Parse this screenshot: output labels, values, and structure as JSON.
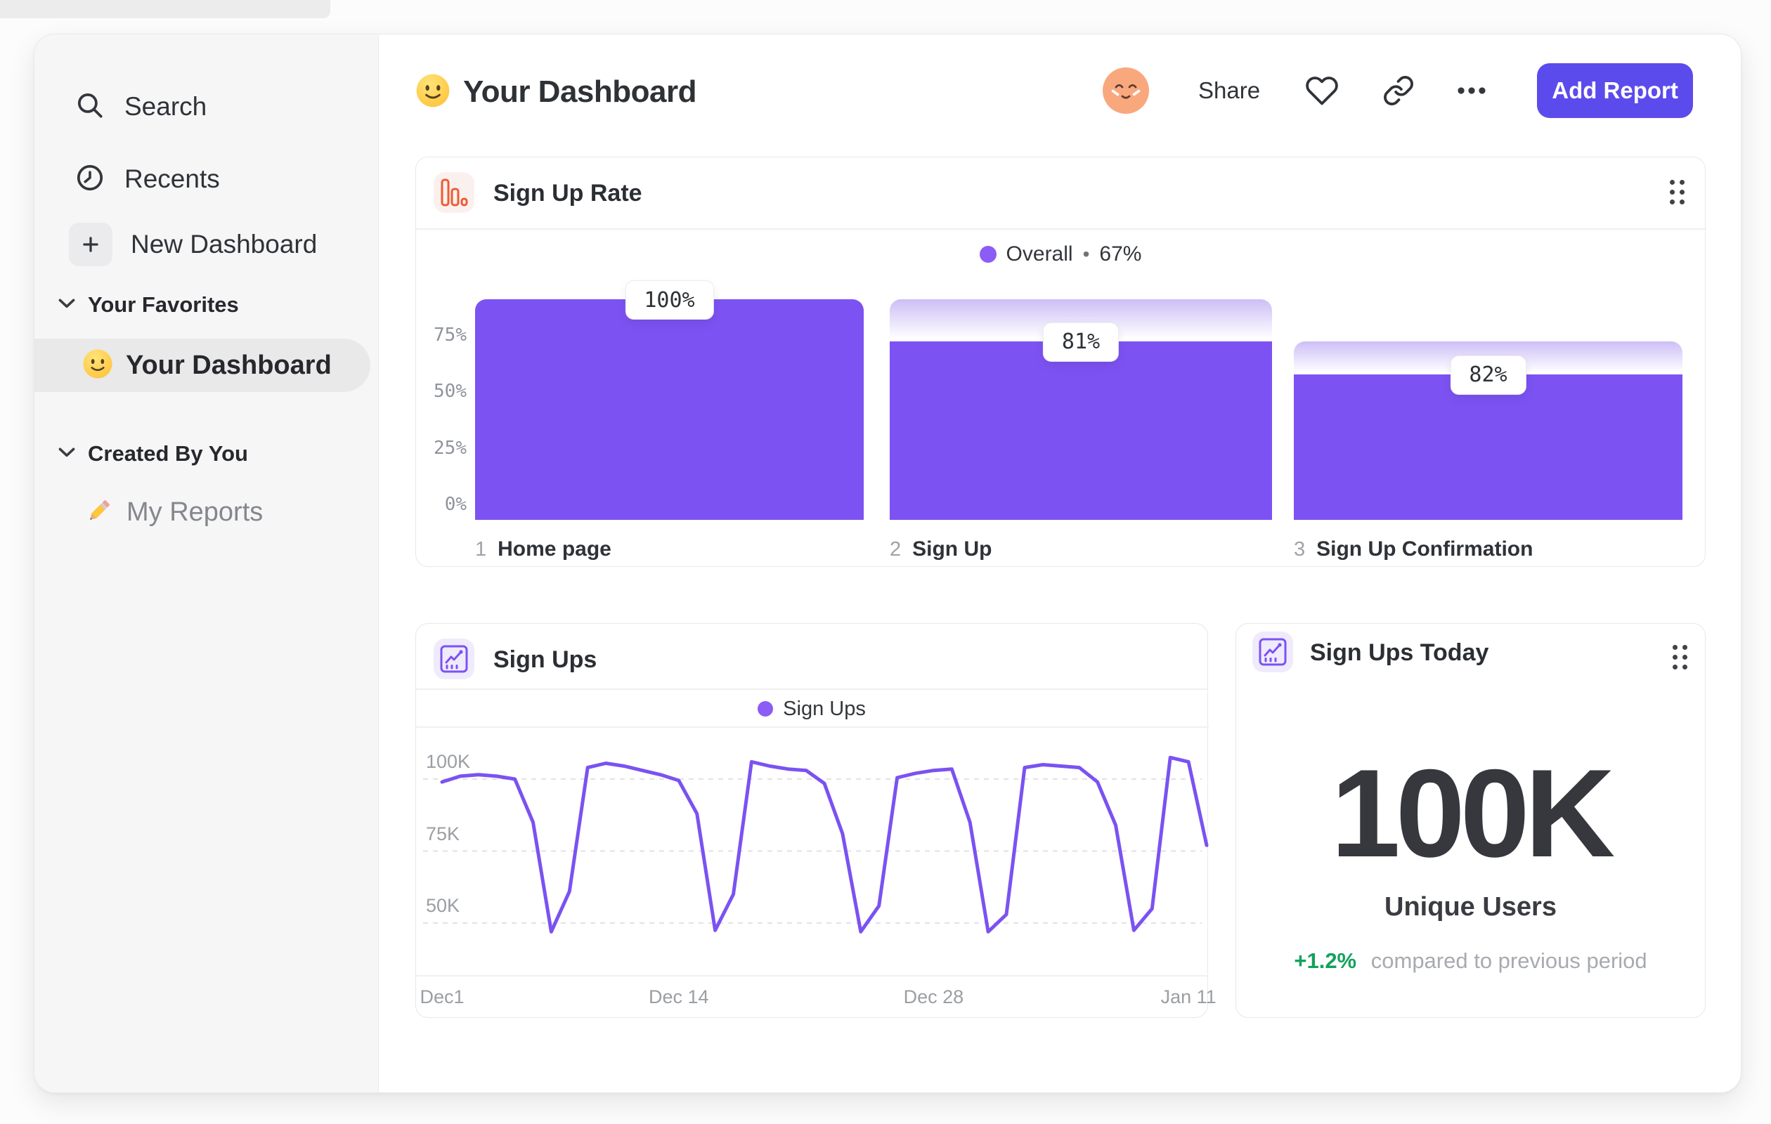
{
  "legend_bullet": "•",
  "sidebar": {
    "items": [
      {
        "label": "Search",
        "icon": "search"
      },
      {
        "label": "Recents",
        "icon": "clock-history"
      },
      {
        "label": "New Dashboard",
        "icon": "plus"
      }
    ],
    "sections": [
      {
        "title": "Your Favorites",
        "items": [
          {
            "label": "Your Dashboard",
            "emoji": "slightly-smiling-face",
            "selected": true
          }
        ]
      },
      {
        "title": "Created By You",
        "items": [
          {
            "label": "My Reports",
            "emoji": "pencil",
            "selected": false
          }
        ]
      }
    ]
  },
  "header": {
    "title": "Your Dashboard",
    "title_emoji": "slightly-smiling-face",
    "avatar": "relieved-face-on-peach-circle",
    "share_label": "Share",
    "icons": [
      "heart",
      "link",
      "ellipsis"
    ],
    "add_report_label": "Add Report",
    "accent_color": "#5C4BEC"
  },
  "colors": {
    "bar_purple": "#7C52F2",
    "line_purple": "#7B52F1",
    "legend_dot": "#8B5CF6",
    "delta_green": "#11A25C",
    "funnel_icon_orange": "#EE5B33"
  },
  "chart_data": [
    {
      "type": "bar",
      "subtype": "funnel",
      "title": "Sign Up Rate",
      "legend": {
        "label": "Overall",
        "value": "67%",
        "color": "#8B5CF6"
      },
      "ylim": [
        0,
        100
      ],
      "y_ticks": [
        "75%",
        "50%",
        "25%",
        "0%"
      ],
      "bar_color": "#7C52F2",
      "steps": [
        {
          "step": "1",
          "name": "Home page",
          "label": "100%",
          "conversion_from_prev_pct": 100,
          "solid_pct": 100,
          "ghost_top_pct": 100
        },
        {
          "step": "2",
          "name": "Sign Up",
          "label": "81%",
          "conversion_from_prev_pct": 81,
          "solid_pct": 81,
          "ghost_top_pct": 100
        },
        {
          "step": "3",
          "name": "Sign Up Confirmation",
          "label": "82%",
          "conversion_from_prev_pct": 82,
          "solid_pct": 66,
          "ghost_top_pct": 81
        }
      ]
    },
    {
      "type": "line",
      "title": "Sign Ups",
      "series_name": "Sign Ups",
      "color": "#7B52F1",
      "grid": "dashed horizontal",
      "legend_position": "top-center",
      "ylim_k": [
        31,
        118
      ],
      "y_gridlines": [
        {
          "label": "100K",
          "value": 100
        },
        {
          "label": "75K",
          "value": 75
        },
        {
          "label": "50K",
          "value": 50
        }
      ],
      "x_ticks": [
        {
          "label": "Dec1",
          "day": 0
        },
        {
          "label": "Dec 14",
          "day": 13
        },
        {
          "label": "Dec 28",
          "day": 27
        },
        {
          "label": "Jan 11",
          "day": 41
        }
      ],
      "values_k": [
        99,
        101,
        101.5,
        101,
        100,
        85,
        47,
        61,
        104,
        105.5,
        104.5,
        103,
        101.5,
        99.5,
        88,
        47.5,
        60,
        106,
        104.5,
        103.5,
        103,
        98.5,
        81,
        47,
        56,
        100.5,
        102,
        103,
        103.5,
        85,
        47,
        53,
        104,
        105,
        104.5,
        104,
        99,
        84,
        47.5,
        55,
        107.5,
        106,
        77
      ]
    },
    {
      "type": "metric",
      "title": "Sign Ups Today",
      "value": "100K",
      "label": "Unique Users",
      "delta": "+1.2%",
      "delta_positive": true,
      "note": "compared to previous period"
    }
  ]
}
